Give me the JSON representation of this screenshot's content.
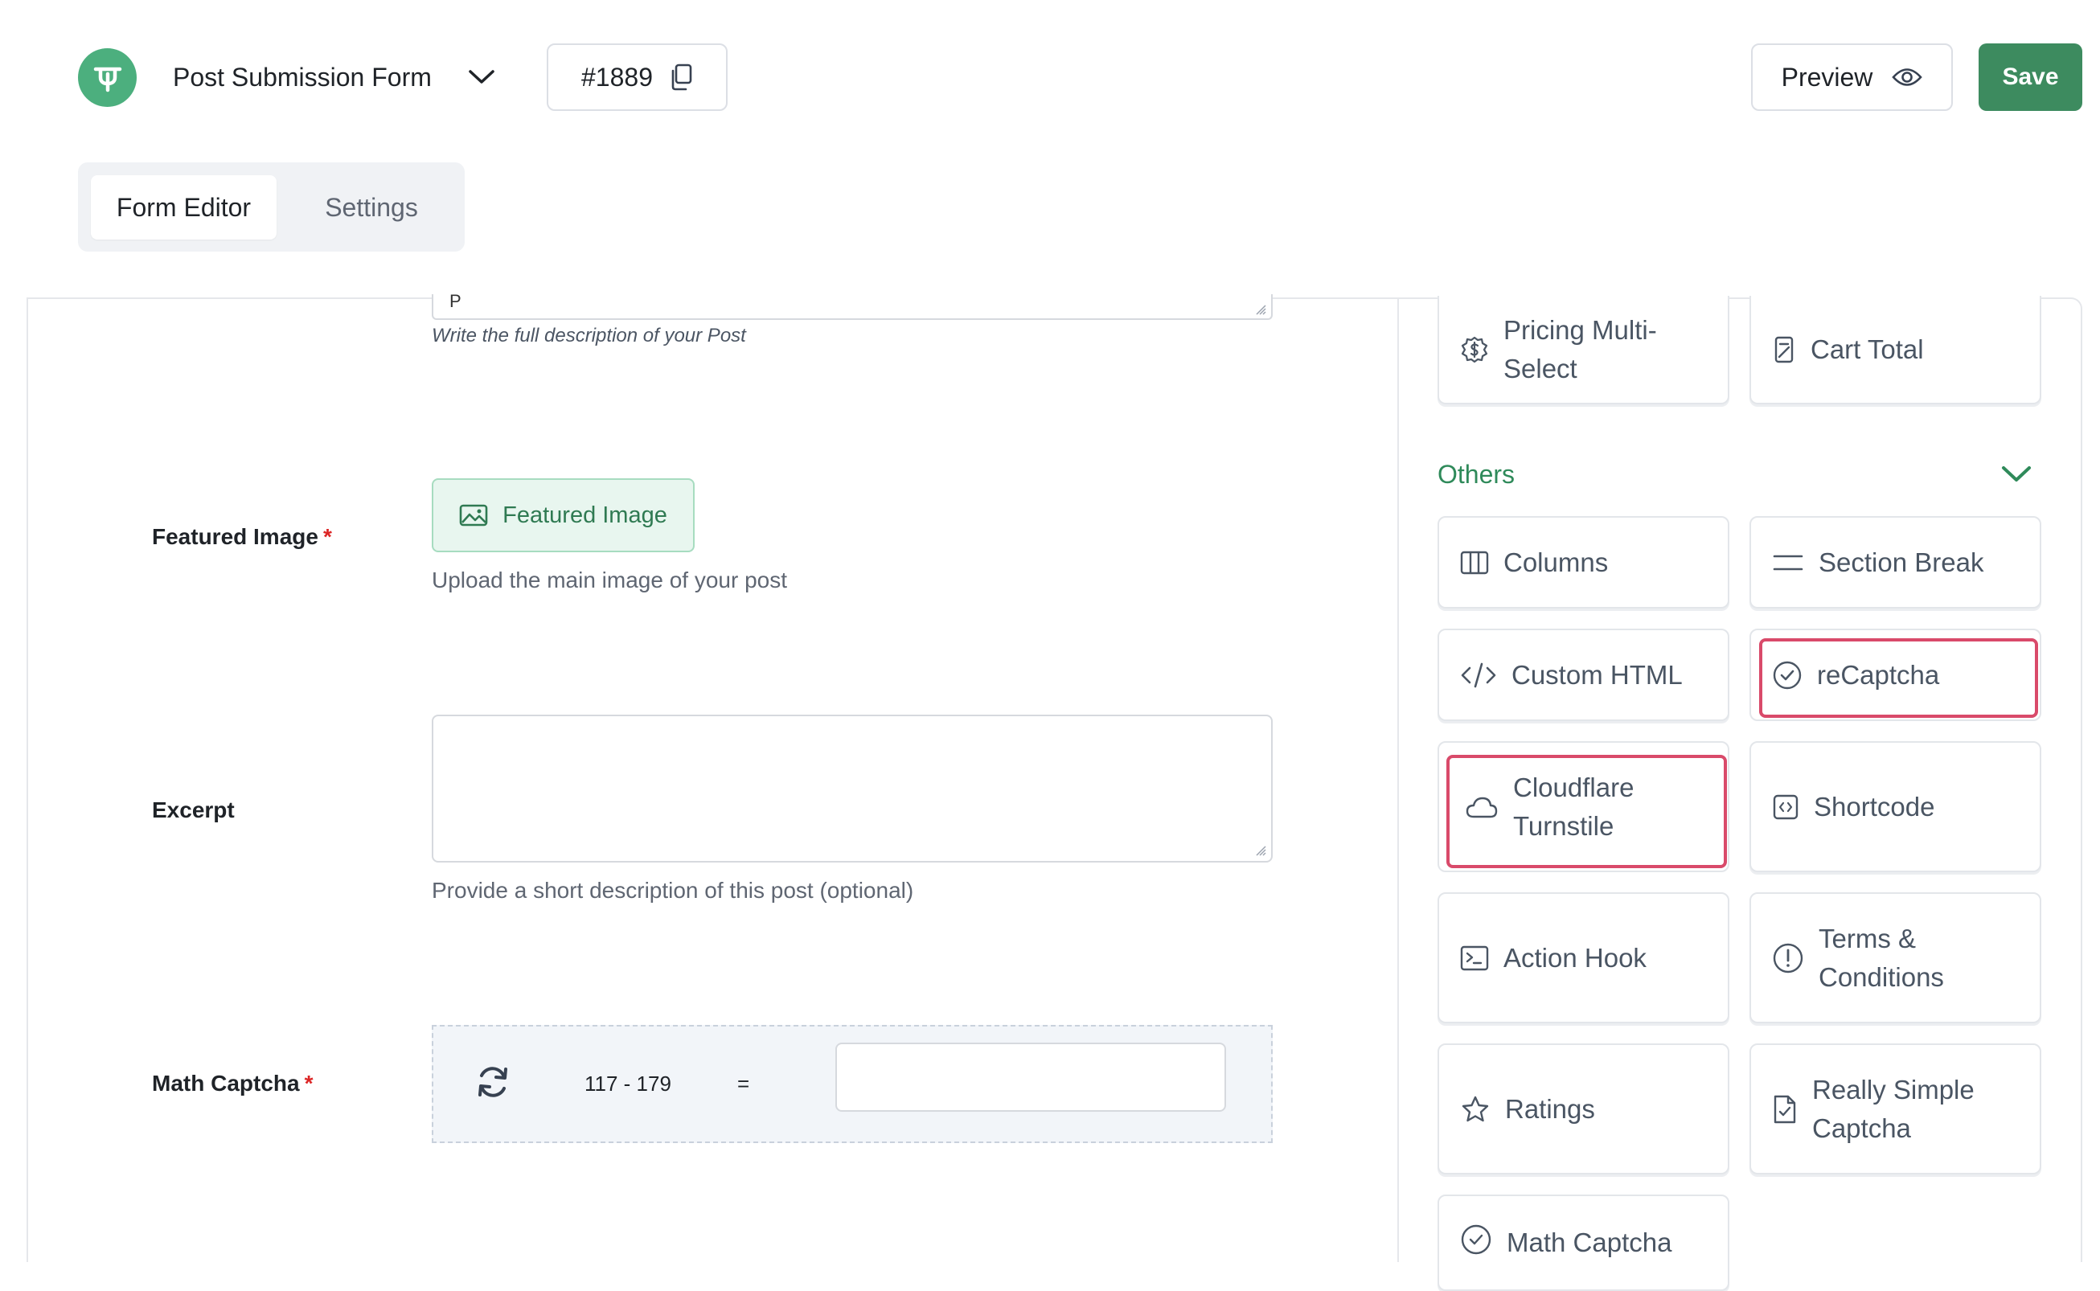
{
  "header": {
    "form_name": "Post Submission Form",
    "form_id": "#1889",
    "preview_label": "Preview",
    "save_label": "Save"
  },
  "tabs": [
    {
      "label": "Form Editor",
      "active": true
    },
    {
      "label": "Settings",
      "active": false
    }
  ],
  "editor": {
    "description_textarea_value": "P",
    "description_help": "Write the full description of your Post",
    "featured_image": {
      "label": "Featured Image",
      "required_mark": "*",
      "button_label": "Featured Image",
      "help": "Upload the main image of your post"
    },
    "excerpt": {
      "label": "Excerpt",
      "value": "",
      "help": "Provide a short description of this post (optional)"
    },
    "math_captcha": {
      "label": "Math Captcha",
      "required_mark": "*",
      "question": "117 - 179",
      "equals": "=",
      "answer": ""
    }
  },
  "sidebar": {
    "top_cards": [
      {
        "label": "Pricing Multi-Select",
        "icon": "dollar-circle-icon"
      },
      {
        "label": "Cart Total",
        "icon": "calculator-icon"
      }
    ],
    "others_section": {
      "title": "Others",
      "expanded": true,
      "items": [
        {
          "label": "Columns",
          "icon": "columns-icon",
          "highlighted": false
        },
        {
          "label": "Section Break",
          "icon": "section-break-icon",
          "highlighted": false
        },
        {
          "label": "Custom HTML",
          "icon": "code-icon",
          "highlighted": false
        },
        {
          "label": "reCaptcha",
          "icon": "check-badge-icon",
          "highlighted": true
        },
        {
          "label": "Cloudflare Turnstile",
          "icon": "cloud-icon",
          "highlighted": true
        },
        {
          "label": "Shortcode",
          "icon": "shortcode-icon",
          "highlighted": false
        },
        {
          "label": "Action Hook",
          "icon": "terminal-icon",
          "highlighted": false
        },
        {
          "label": "Terms & Conditions",
          "icon": "exclamation-circle-icon",
          "highlighted": false
        },
        {
          "label": "Ratings",
          "icon": "star-icon",
          "highlighted": false
        },
        {
          "label": "Really Simple Captcha",
          "icon": "document-check-icon",
          "highlighted": false
        },
        {
          "label": "Math Captcha",
          "icon": "math-captcha-icon",
          "highlighted": false
        }
      ]
    }
  },
  "colors": {
    "brand_green": "#3d8b5f",
    "logo_green": "#4caf7e",
    "highlight_red": "#d94a6a",
    "required_red": "#dc2626"
  }
}
